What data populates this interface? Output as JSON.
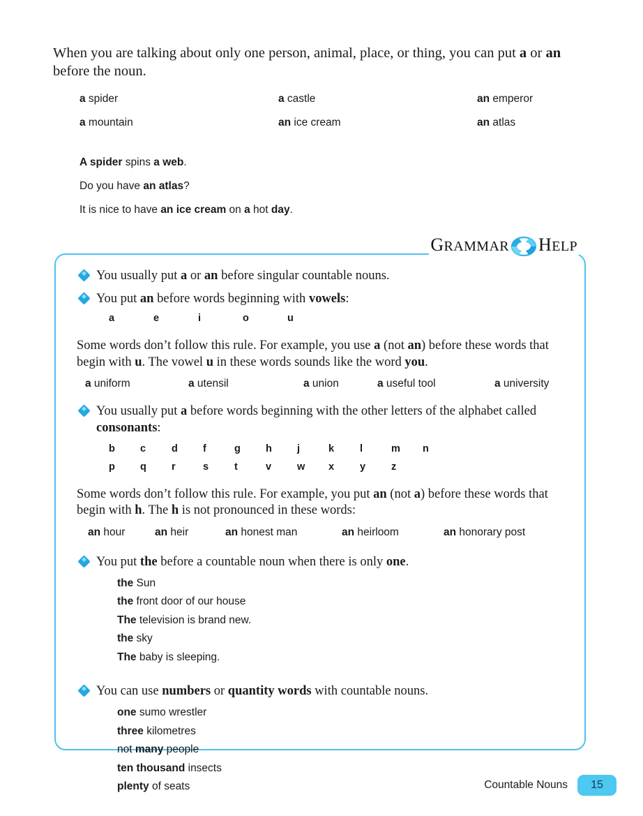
{
  "intro": {
    "line1_a": "When you are talking about only one person, animal, place, or thing, you can put ",
    "bold1": "a",
    "line1_b": " or ",
    "bold2": "an",
    "line1_c": " before the noun."
  },
  "examples_top": [
    [
      {
        "bold": "a",
        "rest": " spider"
      },
      {
        "bold": "a",
        "rest": " castle"
      },
      {
        "bold": "an",
        "rest": " emperor"
      }
    ],
    [
      {
        "bold": "a",
        "rest": " mountain"
      },
      {
        "bold": "an",
        "rest": " ice cream"
      },
      {
        "bold": "an",
        "rest": " atlas"
      }
    ]
  ],
  "sentences": [
    {
      "p1": "",
      "b1": "A spider",
      "p2": " spins ",
      "b2": "a web",
      "p3": "."
    },
    {
      "p1": "Do you have ",
      "b1": "an atlas",
      "p2": "?",
      "b2": "",
      "p3": ""
    },
    {
      "p1": "It is nice to have ",
      "b1": "an ice cream",
      "p2": " on ",
      "b2": "a",
      "p3": " hot ",
      "b3": "day",
      "p4": "."
    }
  ],
  "grammar_help": {
    "word1_cap": "G",
    "word1_rest": "RAMMAR",
    "icon": "life-ring-icon",
    "word2_cap": "H",
    "word2_rest": "ELP",
    "accent_color": "#4cc3ee"
  },
  "help_box": {
    "border_color": "#4cc3ee",
    "bullet_color": "#22a9e0",
    "bullets": {
      "b1": {
        "p1": "You usually put ",
        "b1": "a",
        "p2": " or ",
        "b2": "an",
        "p3": " before singular countable nouns."
      },
      "b2": {
        "p1": "You put ",
        "b1": "an",
        "p2": " before words beginning with ",
        "b2": "vowels",
        "p3": ":"
      },
      "b3": {
        "p1": "You usually put ",
        "b1": "a",
        "p2": " before words beginning with the other letters of  the alphabet called ",
        "b2": "consonants",
        "p3": ":"
      },
      "b4": {
        "p1": "You put ",
        "b1": "the",
        "p2": " before a countable noun when there is only ",
        "b2": "one",
        "p3": "."
      },
      "b5": {
        "p1": "You can use ",
        "b1": "numbers",
        "p2": " or ",
        "b2": "quantity words",
        "p3": " with countable nouns."
      }
    },
    "vowels": [
      "a",
      "e",
      "i",
      "o",
      "u"
    ],
    "consonants_row1": [
      "b",
      "c",
      "d",
      "f",
      "g",
      "h",
      "j",
      "k",
      "l",
      "m",
      "n"
    ],
    "consonants_row2": [
      "p",
      "q",
      "r",
      "s",
      "t",
      "v",
      "w",
      "x",
      "y",
      "z"
    ],
    "u_note": {
      "p1": "Some words don’t follow this rule. For example, you use ",
      "b1": "a",
      "p2": " (not ",
      "b2": "an",
      "p3": ") before these words that begin with ",
      "b3": "u",
      "p4": ". The vowel ",
      "b4": "u",
      "p5": " in these words sounds like the word ",
      "b5": "you",
      "p6": "."
    },
    "u_words": [
      {
        "bold": "a",
        "rest": " uniform"
      },
      {
        "bold": "a",
        "rest": " utensil"
      },
      {
        "bold": "a",
        "rest": " union"
      },
      {
        "bold": "a",
        "rest": " useful tool"
      },
      {
        "bold": "a",
        "rest": " university"
      }
    ],
    "h_note": {
      "p1": "Some words don’t follow this rule. For example, you put ",
      "b1": "an",
      "p2": " (not ",
      "b2": "a",
      "p3": ") before these words that begin with ",
      "b3": "h",
      "p4": ". The ",
      "b4": "h",
      "p5": " is not pronounced in these words:"
    },
    "h_words": [
      {
        "bold": "an",
        "rest": " hour"
      },
      {
        "bold": "an",
        "rest": " heir"
      },
      {
        "bold": "an",
        "rest": " honest man"
      },
      {
        "bold": "an",
        "rest": " heirloom"
      },
      {
        "bold": "an",
        "rest": " honorary post"
      }
    ],
    "the_examples": [
      {
        "bold": "the",
        "rest": " Sun"
      },
      {
        "bold": "the",
        "rest": " front door of our house"
      },
      {
        "bold": "The",
        "rest": " television is brand new."
      },
      {
        "bold": "the",
        "rest": " sky"
      },
      {
        "bold": "The",
        "rest": " baby is sleeping."
      }
    ],
    "quantity_examples": [
      {
        "pre": "",
        "bold": "one",
        "rest": " sumo wrestler"
      },
      {
        "pre": "",
        "bold": "three",
        "rest": " kilometres"
      },
      {
        "pre": "not ",
        "bold": "many",
        "rest": " people"
      },
      {
        "pre": "",
        "bold": "ten thousand",
        "rest": " insects"
      },
      {
        "pre": "",
        "bold": "plenty",
        "rest": " of seats"
      }
    ]
  },
  "footer": {
    "label": "Countable Nouns",
    "page_number": "15",
    "pill_color": "#4dc8f0"
  }
}
